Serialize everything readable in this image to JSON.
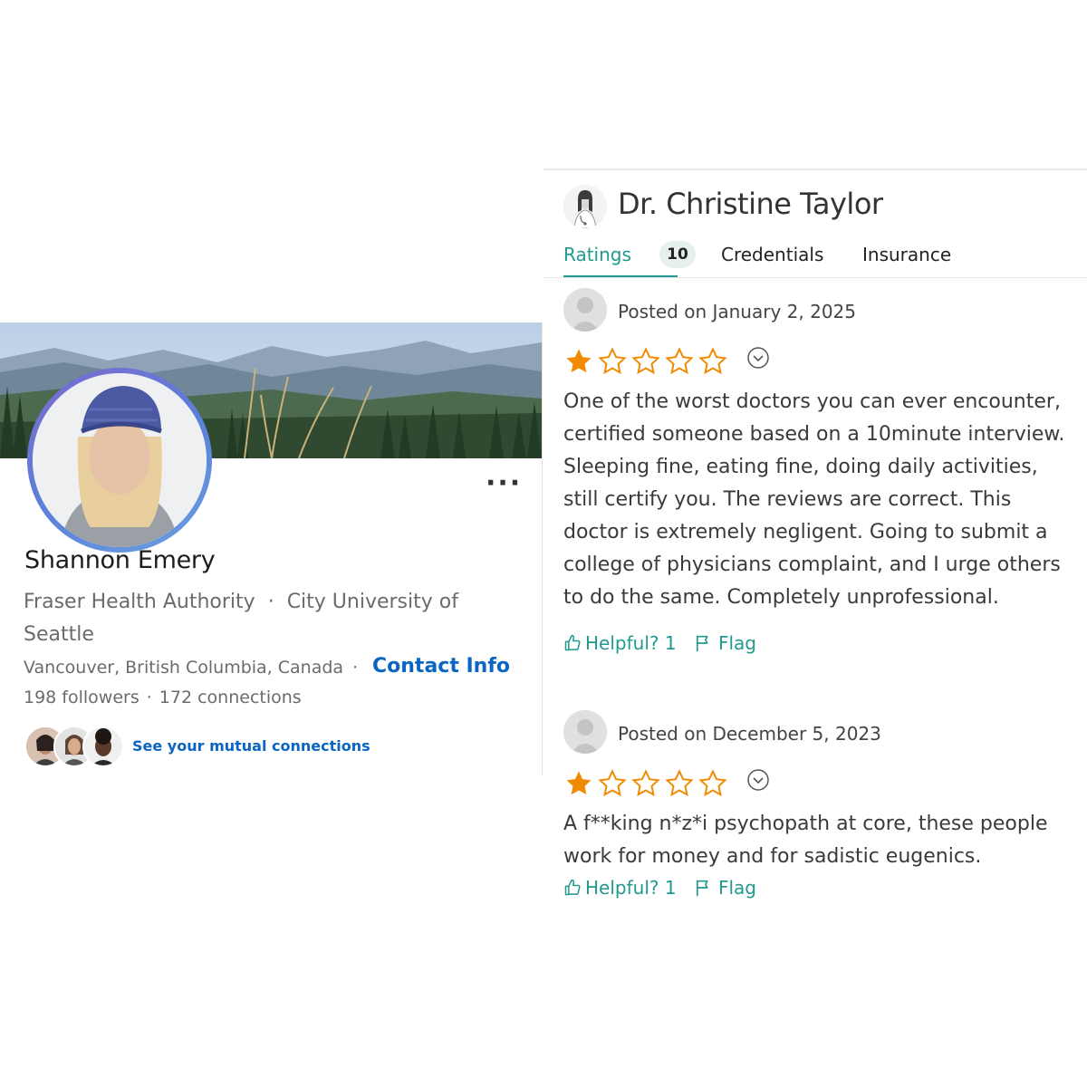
{
  "profile": {
    "name": "Shannon Emery",
    "headline_org": "Fraser Health Authority",
    "headline_sep": "·",
    "headline_edu": "City University of Seattle",
    "location": "Vancouver, British Columbia, Canada",
    "location_sep": "·",
    "contact_label": "Contact Info",
    "followers": "198 followers",
    "follow_sep": "·",
    "connections": "172 connections",
    "mutual_label": "See your mutual connections",
    "more_label": "···",
    "accent_color": "#0a66c2"
  },
  "doctor": {
    "name": "Dr. Christine Taylor",
    "tabs": [
      {
        "label": "Ratings",
        "badge": "10",
        "active": true
      },
      {
        "label": "Credentials"
      },
      {
        "label": "Insurance"
      }
    ],
    "accent_color": "#1f9a8e",
    "star_color": "#f08a00"
  },
  "reviews": [
    {
      "posted": "Posted on January 2, 2025",
      "rating": 1,
      "max_rating": 5,
      "text": "One of the worst doctors you can ever encounter, certified someone based on a 10minute interview. Sleeping fine, eating fine, doing daily activities, still certify you. The reviews are correct. This doctor is extremely negligent. Going to submit a college of physicians complaint, and I urge others to do the same. Completely unprofessional.",
      "helpful_label": "Helpful? 1",
      "flag_label": "Flag"
    },
    {
      "posted": "Posted on December 5, 2023",
      "rating": 1,
      "max_rating": 5,
      "text": "A f**king n*z*i psychopath at core, these people work for money and for sadistic eugenics.",
      "helpful_label": "Helpful? 1",
      "flag_label": "Flag"
    }
  ],
  "icons": [
    "thumbs-up-icon",
    "flag-icon",
    "chevron-down-icon",
    "star-icon",
    "more-icon"
  ]
}
